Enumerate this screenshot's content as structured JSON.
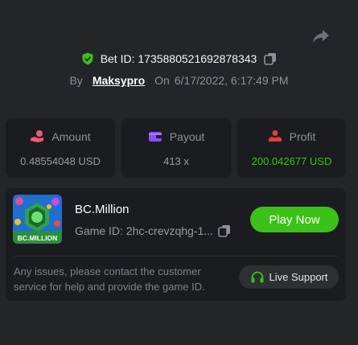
{
  "bet": {
    "label": "Bet ID: 1735880521692878343",
    "by_label": "By",
    "username": "Maksypro",
    "on_label": "On",
    "datetime": "6/17/2022, 6:17:49 PM"
  },
  "stats": {
    "amount": {
      "label": "Amount",
      "value": "0.48554048 USD"
    },
    "payout": {
      "label": "Payout",
      "value": "413 x"
    },
    "profit": {
      "label": "Profit",
      "value": "200.042677 USD"
    }
  },
  "game": {
    "name": "BC.Million",
    "id_text": "Game ID: 2hc-crevzqhg-1...",
    "thumb_text": "BC.MILLION",
    "play_label": "Play Now",
    "issue_text": "Any issues, please contact the customer service for help and provide the game ID.",
    "support_label": "Live Support"
  },
  "icons": {
    "share": "share-arrow-icon",
    "shield": "shield-check-icon",
    "copy": "copy-icon",
    "amount": "coin-hand-icon",
    "payout": "wallet-icon",
    "profit": "profit-hand-icon",
    "support": "headset-icon"
  },
  "colors": {
    "background": "#232528",
    "card": "#1b1c1f",
    "accent_green": "#3bc117",
    "muted_text": "#8e9196",
    "amount_icon": "#f05a7a",
    "payout_icon": "#8a4fff",
    "profit_icon": "#e83c3c"
  }
}
